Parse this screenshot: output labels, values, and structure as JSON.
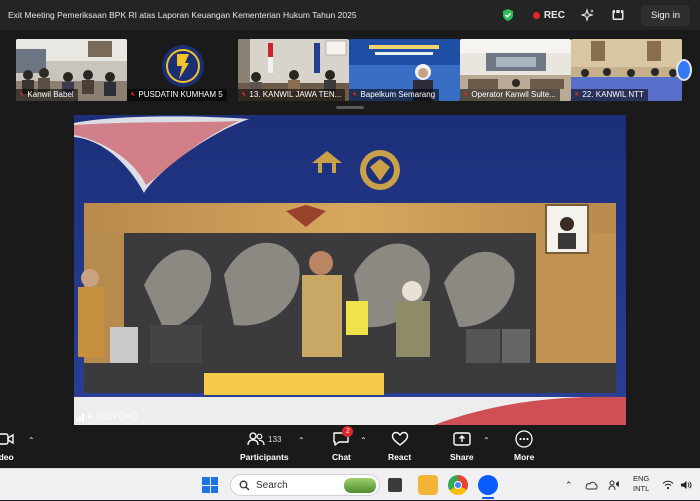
{
  "window": {
    "title": "Exit Meeting Pemeriksaan BPK RI atas Laporan Keuangan Kementerian Hukum Tahun 2025",
    "recording_label": "REC",
    "sign_in_label": "Sign in"
  },
  "participants_strip": [
    {
      "name": "Kanwil Babel"
    },
    {
      "name": "PUSDATIN KUMHAM 5"
    },
    {
      "name": "13. KANWIL JAWA TEN..."
    },
    {
      "name": "Bapelkum Semarang"
    },
    {
      "name": "Operator Kanwil Sulte..."
    },
    {
      "name": "22. KANWIL NTT"
    }
  ],
  "main_video": {
    "speaker_name": "R.SOEPOMO"
  },
  "toolbar": {
    "video_label": "ideo",
    "participants_label": "Participants",
    "participants_count": "133",
    "chat_label": "Chat",
    "chat_badge": "2",
    "react_label": "React",
    "share_label": "Share",
    "more_label": "More"
  },
  "taskbar": {
    "search_placeholder": "Search",
    "lang_top": "ENG",
    "lang_bottom": "INTL"
  },
  "colors": {
    "accent_red": "#e0262b",
    "windows_blue": "#1e74e6",
    "shield_green": "#2fbf5a"
  }
}
